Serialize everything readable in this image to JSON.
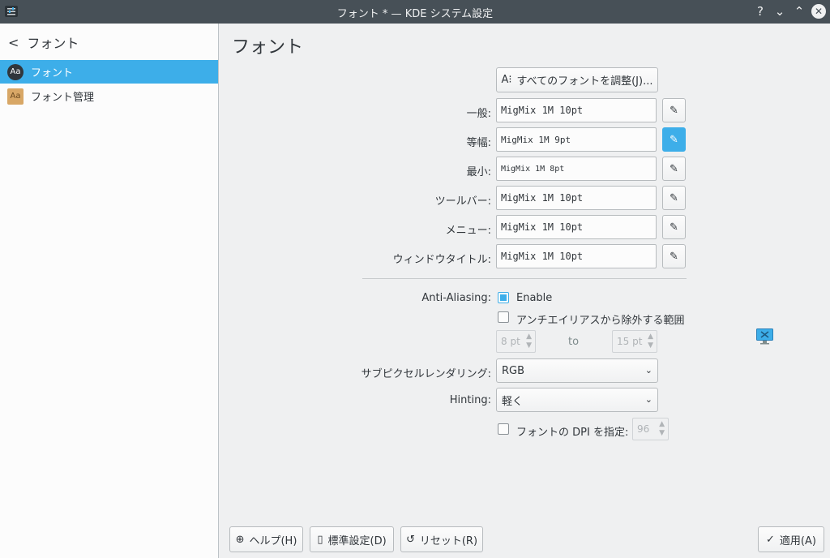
{
  "window": {
    "title": "フォント * — KDE システム設定",
    "help_glyph": "?",
    "minimize_glyph": "⌄",
    "maximize_glyph": "⌃",
    "close_glyph": "✕"
  },
  "sidebar": {
    "back_label": "フォント",
    "items": [
      {
        "label": "フォント",
        "icon_text": "Aa",
        "icon": "font-icon",
        "selected": true
      },
      {
        "label": "フォント管理",
        "icon_text": "Aa",
        "icon": "font-management-icon",
        "selected": false
      }
    ]
  },
  "main": {
    "title": "フォント",
    "adjust_all_label": "すべてのフォントを調整(J)...",
    "adjust_all_icon_text": "A⁝",
    "fonts": [
      {
        "label": "一般:",
        "value": "MigMix 1M 10pt"
      },
      {
        "label": "等幅:",
        "value": "MigMix 1M 9pt"
      },
      {
        "label": "最小:",
        "value": "MigMix 1M 8pt"
      },
      {
        "label": "ツールバー:",
        "value": "MigMix 1M 10pt"
      },
      {
        "label": "メニュー:",
        "value": "MigMix 1M 10pt"
      },
      {
        "label": "ウィンドウタイトル:",
        "value": "MigMix 1M 10pt"
      }
    ],
    "pick_icon_glyph": "✎",
    "antialiasing": {
      "label": "Anti-Aliasing:",
      "enable_label": "Enable",
      "enabled": true,
      "exclude_label": "アンチエイリアスから除外する範囲",
      "exclude_checked": false,
      "from_value": "8 pt",
      "to_label": "to",
      "to_value": "15 pt"
    },
    "subpixel": {
      "label": "サブピクセルレンダリング:",
      "value": "RGB"
    },
    "hinting": {
      "label": "Hinting:",
      "value": "軽く"
    },
    "dpi": {
      "label": "フォントの DPI を指定:",
      "checked": false,
      "value": "96"
    },
    "spin_up": "▲",
    "spin_down": "▼",
    "dropdown_arrow": "⌄"
  },
  "footer": {
    "help_label": "ヘルプ(H)",
    "help_icon": "⊕",
    "defaults_label": "標準設定(D)",
    "defaults_icon": "▯",
    "reset_label": "リセット(R)",
    "reset_icon": "↺",
    "apply_label": "適用(A)",
    "apply_icon": "✓"
  },
  "colors": {
    "accent": "#3daee9",
    "titlebar": "#475057",
    "window_bg": "#eff0f1",
    "sidebar_bg": "#fcfcfc"
  }
}
